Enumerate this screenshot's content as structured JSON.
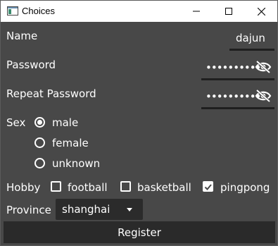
{
  "window": {
    "title": "Choices"
  },
  "form": {
    "name_label": "Name",
    "name_value": "dajun",
    "password_label": "Password",
    "password_value": "••••••••••",
    "repeat_password_label": "Repeat Password",
    "repeat_password_value": "••••••••••",
    "sex_label": "Sex",
    "sex_options": [
      {
        "label": "male",
        "checked": true
      },
      {
        "label": "female",
        "checked": false
      },
      {
        "label": "unknown",
        "checked": false
      }
    ],
    "hobby_label": "Hobby",
    "hobby_options": [
      {
        "label": "football",
        "checked": false
      },
      {
        "label": "basketball",
        "checked": false
      },
      {
        "label": "pingpong",
        "checked": true
      }
    ],
    "province_label": "Province",
    "province_value": "shanghai",
    "register_label": "Register"
  },
  "icons": {
    "app": "window-icon",
    "minimize": "minimize-icon",
    "maximize": "maximize-icon",
    "close": "close-icon",
    "password_visibility": "eye-off-icon",
    "dropdown": "chevron-down-icon"
  },
  "colors": {
    "background": "#484848",
    "field_background": "#2b2b2b",
    "text": "#ffffff",
    "titlebar": "#ffffff"
  }
}
